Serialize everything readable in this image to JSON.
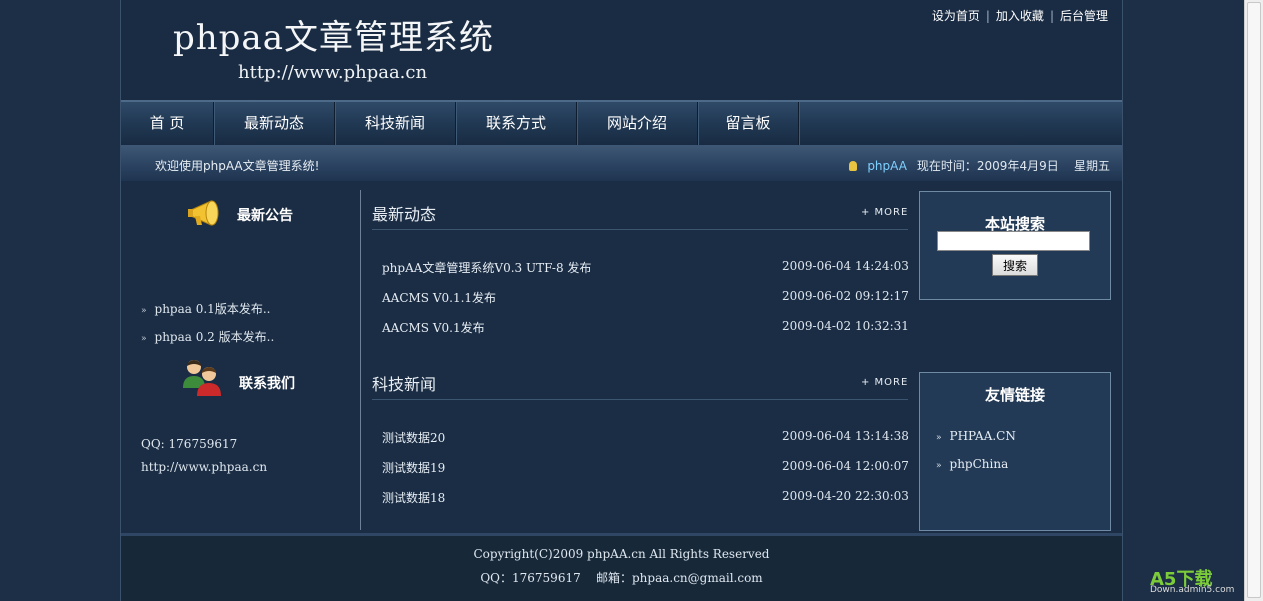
{
  "header": {
    "logo_title": "phpaa文章管理系统",
    "logo_url": "http://www.phpaa.cn",
    "toplinks": [
      "设为首页",
      "加入收藏",
      "后台管理"
    ]
  },
  "nav": {
    "items": [
      "首 页",
      "最新动态",
      "科技新闻",
      "联系方式",
      "网站介绍",
      "留言板"
    ]
  },
  "welcome": {
    "text": "欢迎使用phpAA文章管理系统!",
    "user": "phpAA",
    "time_label": "现在时间：2009年4月9日",
    "weekday": "星期五"
  },
  "left": {
    "announce_title": "最新公告",
    "announcements": [
      "phpaa 0.1版本发布..",
      "phpaa 0.2 版本发布.."
    ],
    "contact_title": "联系我们",
    "contact_qq": "QQ: 176759617",
    "contact_url": "http://www.phpaa.cn"
  },
  "news": {
    "more_label": "+ MORE",
    "latest_title": "最新动态",
    "latest": [
      {
        "title": "phpAA文章管理系统V0.3 UTF-8 发布",
        "date": "2009-06-04 14:24:03"
      },
      {
        "title": "AACMS V0.1.1发布",
        "date": "2009-06-02 09:12:17"
      },
      {
        "title": "AACMS V0.1发布",
        "date": "2009-04-02 10:32:31"
      }
    ],
    "tech_title": "科技新闻",
    "tech": [
      {
        "title": "测试数据20",
        "date": "2009-06-04 13:14:38"
      },
      {
        "title": "测试数据19",
        "date": "2009-06-04 12:00:07"
      },
      {
        "title": "测试数据18",
        "date": "2009-04-20 22:30:03"
      }
    ]
  },
  "search": {
    "title": "本站搜索",
    "button": "搜索",
    "value": ""
  },
  "links": {
    "title": "友情链接",
    "items": [
      "PHPAA.CN",
      "phpChina"
    ]
  },
  "footer": {
    "copyright": "Copyright(C)2009 phpAA.cn All Rights Reserved",
    "contact": "QQ：176759617    邮箱：phpaa.cn@gmail.com"
  },
  "watermark": {
    "logo": "A5下载",
    "site": "Down.admin5.com"
  }
}
